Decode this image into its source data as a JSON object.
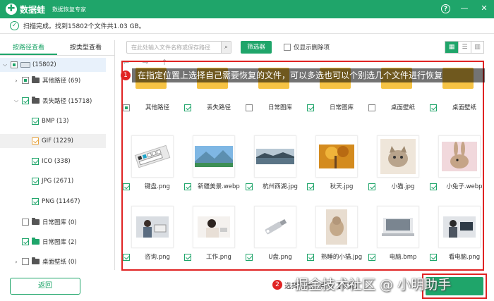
{
  "app": {
    "name": "数据蛙",
    "subtitle": "数据恢复专家",
    "logo_glyph": "✚",
    "accent": "#1fa56a"
  },
  "window": {
    "help": "?",
    "minimize": "—",
    "close": "✕"
  },
  "status": {
    "icon": "check-circle-icon",
    "text": "扫描完成。找到15802个文件共1.03 GB。"
  },
  "sidebar": {
    "tabs": [
      {
        "label": "按路径查看"
      },
      {
        "label": "按类型查看"
      }
    ],
    "tree": [
      {
        "label": "(15802)",
        "state": "checked"
      },
      {
        "label": "其他路径 (69)",
        "state": "partial"
      },
      {
        "label": "丢失路径 (15718)",
        "state": "checked"
      },
      {
        "label": "BMP (13)",
        "state": "checked"
      },
      {
        "label": "GIF (1229)",
        "state": "checked"
      },
      {
        "label": "ICO (338)",
        "state": "checked"
      },
      {
        "label": "JPG (2671)",
        "state": "checked"
      },
      {
        "label": "PNG (11467)",
        "state": "checked"
      },
      {
        "label": "日常图库 (0)",
        "state": "unchecked"
      },
      {
        "label": "日常图库 (2)",
        "state": "checked"
      },
      {
        "label": "桌面壁纸 (0)",
        "state": "unchecked"
      }
    ]
  },
  "toolbar": {
    "path_placeholder": "在此处输入文件名称或保存路径",
    "filter_label": "筛选器",
    "only_deleted_label": "仅显示删除项",
    "view_grid": "▦",
    "view_list": "☰",
    "view_detail": "▥"
  },
  "nav": {
    "back": "←",
    "forward": "→",
    "up": "↑"
  },
  "grid": {
    "row1": [
      {
        "label": "其他路径",
        "state": "partial"
      },
      {
        "label": "丢失路径",
        "state": "checked"
      },
      {
        "label": "日常图库",
        "state": "unchecked"
      },
      {
        "label": "日常图库",
        "state": "checked"
      },
      {
        "label": "桌面壁纸",
        "state": "unchecked"
      },
      {
        "label": "桌面壁纸",
        "state": "checked"
      }
    ],
    "row2": [
      {
        "label": "键盘.png",
        "state": "checked"
      },
      {
        "label": "新疆美景.webp",
        "state": "checked"
      },
      {
        "label": "杭州西湖.jpg",
        "state": "checked"
      },
      {
        "label": "秋天.jpg",
        "state": "checked"
      },
      {
        "label": "小猫.jpg",
        "state": "checked"
      },
      {
        "label": "小兔子.webp",
        "state": "checked"
      }
    ],
    "row3": [
      {
        "label": "咨询.png",
        "state": "checked"
      },
      {
        "label": "工作.png",
        "state": "checked"
      },
      {
        "label": "U盘.png",
        "state": "checked"
      },
      {
        "label": "熟睡的小猫.jpg",
        "state": "checked"
      },
      {
        "label": "电脑.bmp",
        "state": "checked"
      },
      {
        "label": "看电脑.png",
        "state": "checked"
      }
    ]
  },
  "annotations": {
    "step1_num": "1",
    "step1_text": "在指定位置上选择自己需要恢复的文件，可以多选也可以个别选几个文件进行恢复",
    "step2_num": "2",
    "step2_text": "选择好后，点击【恢复】"
  },
  "bottom": {
    "back_label": "返回"
  },
  "watermark": "掘金技术社区 @ 小明助手"
}
